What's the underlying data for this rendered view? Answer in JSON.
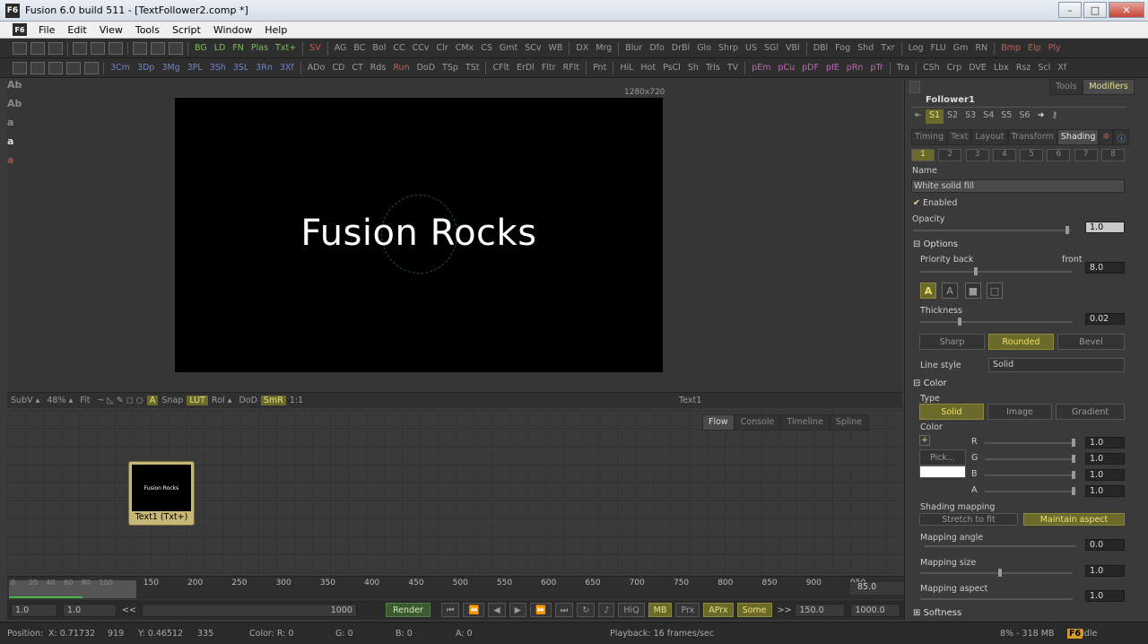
{
  "window": {
    "title": "Fusion 6.0 build 511 - [TextFollower2.comp *]",
    "logo": "F6",
    "buttons": {
      "minimize": "–",
      "maximize": "□",
      "close": "✕"
    }
  },
  "menu": [
    "File",
    "Edit",
    "View",
    "Tools",
    "Script",
    "Window",
    "Help"
  ],
  "toolbar1": {
    "groupA": [
      "BG",
      "LD",
      "FN",
      "Plas",
      "Txt+"
    ],
    "groupB": [
      "SV"
    ],
    "groupC": [
      "AG",
      "BC",
      "Bol",
      "CC",
      "CCv",
      "Clr",
      "CMx",
      "CS",
      "Gmt",
      "SCv",
      "WB"
    ],
    "groupD": [
      "DX",
      "Mrg"
    ],
    "groupE": [
      "Blur",
      "Dfo",
      "DrBl",
      "Glo",
      "Shrp",
      "US",
      "SGl",
      "VBl"
    ],
    "groupF": [
      "DBl",
      "Fog",
      "Shd",
      "Txr"
    ],
    "groupG": [
      "Log",
      "FLU",
      "Gm",
      "RN"
    ],
    "groupH": [
      "Bmp",
      "Elp",
      "Ply"
    ]
  },
  "toolbar2": {
    "groupA": [
      "3Cm",
      "3Dp",
      "3Mg",
      "3PL",
      "3Sh",
      "3SL",
      "3Rn",
      "3Xf"
    ],
    "groupB": [
      "ADo",
      "CD",
      "CT",
      "Rds"
    ],
    "groupB2": [
      "Run"
    ],
    "groupB3": [
      "DoD",
      "TSp",
      "TSt"
    ],
    "groupC": [
      "CFlt",
      "ErDl",
      "Fltr",
      "RFlt"
    ],
    "groupD": [
      "Pnt"
    ],
    "groupE": [
      "HiL",
      "Hot",
      "PsCl",
      "Sh",
      "Trls",
      "TV"
    ],
    "groupF": [
      "pEm",
      "pCu",
      "pDF",
      "pIE",
      "pRn",
      "pTr"
    ],
    "groupG": [
      "Tra"
    ],
    "groupH": [
      "CSh",
      "Crp",
      "DVE",
      "Lbx",
      "Rsz",
      "Scl",
      "Xf"
    ]
  },
  "leftStrip": [
    "Ab",
    "Ab",
    "a",
    "a",
    "a"
  ],
  "viewer": {
    "resolution": "1280x720",
    "text": "Fusion Rocks",
    "bar": {
      "subv": "SubV ▴",
      "zoom": "48% ▴",
      "fit": "Fit",
      "channels": "A",
      "snap": "Snap",
      "lut": "LUT",
      "roi": "RoI ▴",
      "dod": "DoD",
      "smr": "SmR",
      "oneone": "1:1",
      "toolName": "Text1"
    }
  },
  "flow": {
    "tabs": [
      "Flow",
      "Console",
      "Timeline",
      "Spline"
    ],
    "node": {
      "label": "Text1 (Txt+)",
      "thumbText": "Fusion Rocks"
    }
  },
  "ruler": {
    "ticks": [
      "0",
      "20",
      "40",
      "60",
      "80",
      "100",
      "150",
      "200",
      "250",
      "300",
      "350",
      "400",
      "450",
      "500",
      "550",
      "600",
      "650",
      "700",
      "750",
      "800",
      "850",
      "900",
      "950"
    ],
    "current": "85.0"
  },
  "transport": {
    "start": "1.0",
    "renderStart": "1.0",
    "rewind": "<<",
    "end": "1000",
    "render": "Render",
    "hiq": "HiQ",
    "mb": "MB",
    "prx": "Prx",
    "aprx": "APrx",
    "some": "Some",
    "ff": ">>",
    "renderEnd": "150.0",
    "globalEnd": "1000.0"
  },
  "status": {
    "position": "Position:",
    "x": "X: 0.71732",
    "px": "919",
    "y": "Y: 0.46512",
    "py": "335",
    "colorR": "Color: R: 0",
    "g": "G: 0",
    "b": "B: 0",
    "a": "A: 0",
    "playback": "Playback: 16 frames/sec",
    "memory": "8% - 318 MB",
    "state": "Idle"
  },
  "inspector": {
    "tabs": [
      "Tools",
      "Modifiers"
    ],
    "title": "Follower1",
    "shadingSlots": [
      "S1",
      "S2",
      "S3",
      "S4",
      "S5",
      "S6"
    ],
    "pageTabs": [
      "Timing",
      "Text",
      "Layout",
      "Transform",
      "Shading"
    ],
    "elementNums": [
      "1",
      "2",
      "3",
      "4",
      "5",
      "6",
      "7",
      "8"
    ],
    "nameLabel": "Name",
    "nameValue": "White solid fill",
    "enabled": "Enabled",
    "opacityLabel": "Opacity",
    "opacityValue": "1.0",
    "optionsLabel": "Options",
    "priorityBack": "Priority back",
    "priorityFront": "front",
    "priorityValue": "8.0",
    "thicknessLabel": "Thickness",
    "thicknessValue": "0.02",
    "joinButtons": [
      "Sharp",
      "Rounded",
      "Bevel"
    ],
    "lineStyleLabel": "Line style",
    "lineStyleValue": "Solid",
    "colorSection": "Color",
    "typeLabel": "Type",
    "typeButtons": [
      "Solid",
      "Image",
      "Gradient"
    ],
    "colorLabel": "Color",
    "pickLabel": "Pick...",
    "channels": [
      {
        "ch": "R",
        "value": "1.0"
      },
      {
        "ch": "G",
        "value": "1.0"
      },
      {
        "ch": "B",
        "value": "1.0"
      },
      {
        "ch": "A",
        "value": "1.0"
      }
    ],
    "shadingMappingLabel": "Shading mapping",
    "mappingButtons": [
      "Stretch to fit",
      "Maintain aspect"
    ],
    "mappingAngleLabel": "Mapping angle",
    "mappingAngleValue": "0.0",
    "mappingSizeLabel": "Mapping size",
    "mappingSizeValue": "1.0",
    "mappingAspectLabel": "Mapping aspect",
    "mappingAspectValue": "1.0",
    "softnessLabel": "Softness"
  },
  "colors": {
    "accent": "#f0e070",
    "accentBg": "#6b6a2b",
    "render": "#3c5a30",
    "node": "#c8b878"
  }
}
